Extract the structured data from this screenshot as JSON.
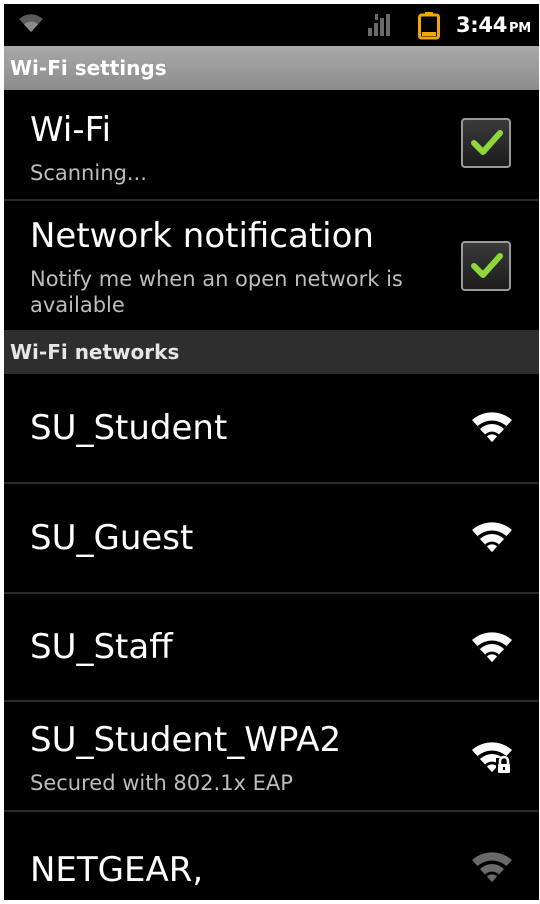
{
  "status_bar": {
    "time": "3:44",
    "ampm": "PM"
  },
  "header": {
    "title": "Wi-Fi settings"
  },
  "settings": [
    {
      "title": "Wi-Fi",
      "summary": "Scanning...",
      "checked": true
    },
    {
      "title": "Network notification",
      "summary": "Notify me when an open network is available",
      "checked": true
    }
  ],
  "networks_header": "Wi-Fi networks",
  "networks": [
    {
      "ssid": "SU_Student",
      "summary": "",
      "icon": "wifi-signal-icon"
    },
    {
      "ssid": "SU_Guest",
      "summary": "",
      "icon": "wifi-signal-icon"
    },
    {
      "ssid": "SU_Staff",
      "summary": "",
      "icon": "wifi-signal-icon"
    },
    {
      "ssid": "SU_Student_WPA2",
      "summary": "Secured with 802.1x EAP",
      "icon": "wifi-lock-icon"
    },
    {
      "ssid": "NETGEAR,",
      "summary": "",
      "icon": "wifi-weak-signal-icon"
    }
  ],
  "colors": {
    "checkmark": "#8fd63a",
    "header_bg": "#9a9a9a",
    "background": "#000000"
  }
}
